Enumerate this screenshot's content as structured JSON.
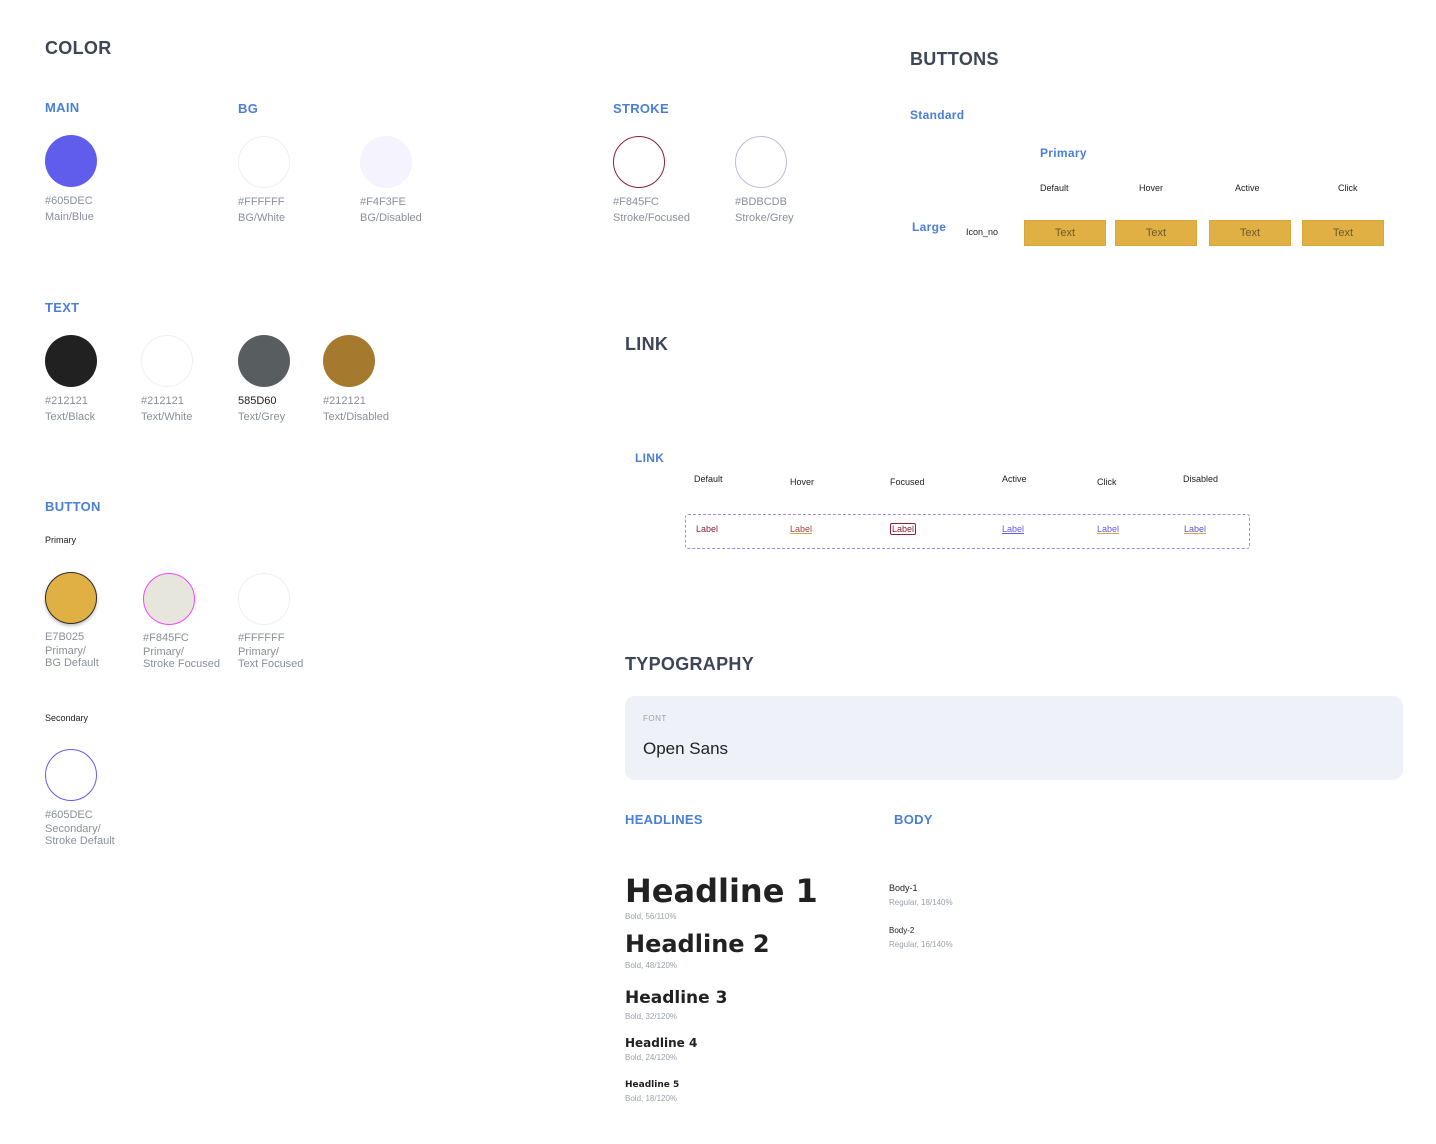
{
  "color": {
    "title": "COLOR",
    "main": {
      "label": "MAIN",
      "swatches": [
        {
          "hex": "#605DEC",
          "name": "Main/Blue",
          "fill": "#605DEC"
        }
      ]
    },
    "bg": {
      "label": "BG",
      "swatches": [
        {
          "hex": "#FFFFFF",
          "name": "BG/White",
          "fill": "#FFFFFF"
        },
        {
          "hex": "#F4F3FE",
          "name": "BG/Disabled",
          "fill": "#F4F3FE"
        }
      ]
    },
    "stroke": {
      "label": "STROKE",
      "swatches": [
        {
          "hex": "#F845FC",
          "name": "Stroke/Focused",
          "stroke": "#8b2035"
        },
        {
          "hex": "#BDBCDB",
          "name": "Stroke/Grey",
          "stroke": "#BDBCDB"
        }
      ]
    },
    "text": {
      "label": "TEXT",
      "swatches": [
        {
          "hex": "#212121",
          "name": "Text/Black",
          "fill": "#212121"
        },
        {
          "hex": "#212121",
          "name": "Text/White",
          "fill": "#FFFFFF"
        },
        {
          "hex": "585D60",
          "name": "Text/Grey",
          "fill": "#585D60"
        },
        {
          "hex": "#212121",
          "name": "Text/Disabled",
          "fill": "#A57A2F"
        }
      ]
    },
    "button": {
      "label": "BUTTON",
      "primary_label": "Primary",
      "primary": [
        {
          "hex": "E7B025",
          "name1": "Primary/",
          "name2": "BG Default",
          "fill": "#E0B044"
        },
        {
          "hex": "#F845FC",
          "name1": "Primary/",
          "name2": "Stroke Focused",
          "fill": "#E6E6DC"
        },
        {
          "hex": "#FFFFFF",
          "name1": "Primary/",
          "name2": "Text Focused",
          "fill": "#FFFFFF"
        }
      ],
      "secondary_label": "Secondary",
      "secondary": [
        {
          "hex": "#605DEC",
          "name1": "Secondary/",
          "name2": "Stroke Default"
        }
      ]
    }
  },
  "buttons": {
    "title": "BUTTONS",
    "group": "Standard",
    "type": "Primary",
    "states": [
      "Default",
      "Hover",
      "Active",
      "Click"
    ],
    "size": "Large",
    "variant": "Icon_no",
    "button_text": [
      "Text",
      "Text",
      "Text",
      "Text"
    ]
  },
  "link": {
    "title": "LINK",
    "sub": "LINK",
    "states": [
      "Default",
      "Hover",
      "Focused",
      "Active",
      "Click",
      "Disabled"
    ],
    "labels": [
      "Label",
      "Label",
      "Label",
      "Label",
      "Label",
      "Label"
    ]
  },
  "typography": {
    "title": "TYPOGRAPHY",
    "font_caption": "FONT",
    "font_name": "Open Sans",
    "headlines_label": "HEADLINES",
    "body_label": "BODY",
    "headlines": [
      {
        "text": "Headline 1",
        "spec": "Bold, 56/110%"
      },
      {
        "text": "Headline 2",
        "spec": "Bold, 48/120%"
      },
      {
        "text": "Headline 3",
        "spec": "Bold, 32/120%"
      },
      {
        "text": "Headline 4",
        "spec": "Bold, 24/120%"
      },
      {
        "text": "Headline 5",
        "spec": "Bold, 18/120%"
      }
    ],
    "body": [
      {
        "text": "Body-1",
        "spec": "Regular, 18/140%"
      },
      {
        "text": "Body-2",
        "spec": "Regular, 16/140%"
      }
    ]
  }
}
